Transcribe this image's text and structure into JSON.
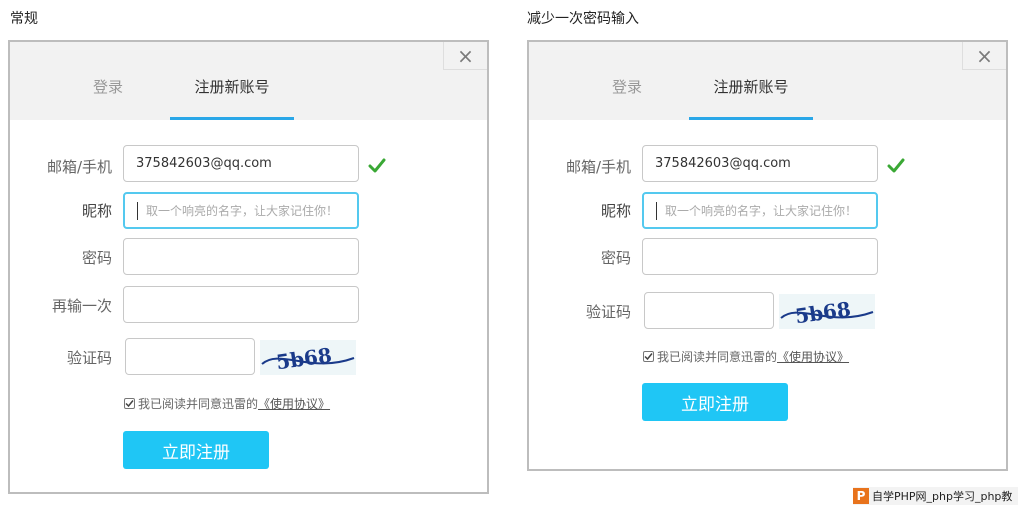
{
  "captions": {
    "left": "常规",
    "right": "减少一次密码输入"
  },
  "left_dialog": {
    "close_glyph": "×",
    "tabs": {
      "login": "登录",
      "register": "注册新账号"
    },
    "fields": {
      "email_label": "邮箱/手机",
      "email_value": "375842603@qq.com",
      "nickname_label": "昵称",
      "nickname_placeholder": "取一个响亮的名字，让大家记住你！",
      "password_label": "密码",
      "password2_label": "再输一次",
      "captcha_label": "验证码",
      "captcha_text": "5b68"
    },
    "agreement": {
      "text": "我已阅读并同意迅雷的",
      "link": "《使用协议》"
    },
    "submit": "立即注册"
  },
  "right_dialog": {
    "close_glyph": "×",
    "tabs": {
      "login": "登录",
      "register": "注册新账号"
    },
    "fields": {
      "email_label": "邮箱/手机",
      "email_value": "375842603@qq.com",
      "nickname_label": "昵称",
      "nickname_placeholder": "取一个响亮的名字，让大家记住你！",
      "password_label": "密码",
      "captcha_label": "验证码",
      "captcha_text": "5b68"
    },
    "agreement": {
      "text": "我已阅读并同意迅雷的",
      "link": "《使用协议》"
    },
    "submit": "立即注册"
  },
  "icons": {
    "close": "close-icon",
    "check": "checkmark-icon",
    "checkbox": "checkbox-icon",
    "logo": "php-logo-icon"
  },
  "colors": {
    "accent_blue": "#1fc6f5",
    "tab_underline": "#2aa7e8",
    "focus_border": "#54c9ef",
    "check_green": "#3aa835",
    "header_bg": "#f2f2f2"
  },
  "watermark": {
    "logo": "P",
    "text": "自学PHP网_php学习_php教"
  }
}
